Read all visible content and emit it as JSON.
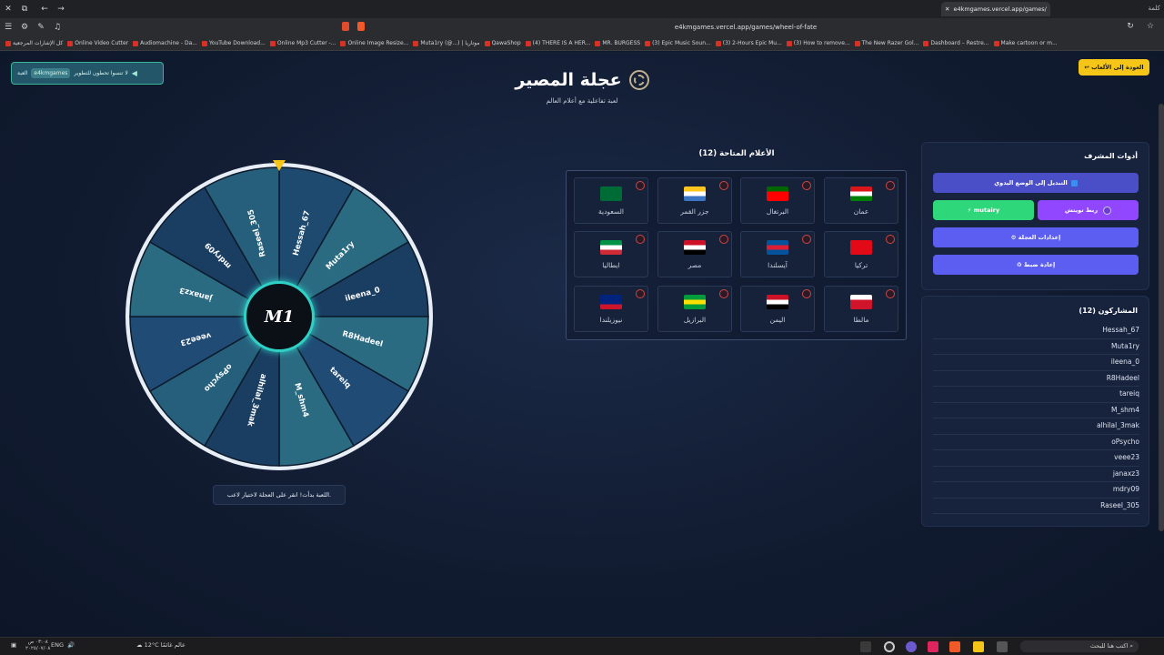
{
  "browser": {
    "tab_title": "e4kmgames.vercel.app/games/",
    "window_title": "كلمة",
    "url": "e4kmgames.vercel.app/games/wheel-of-fate",
    "bookmarks": [
      "كل الإشارات المرجعية",
      "Online Video Cutter",
      "Audiomachine - Da...",
      "YouTube Download...",
      "Online Mp3 Cutter -...",
      "Online Image Resize...",
      "Muta1ry (@...) | موتاريا",
      "QawaShop",
      "(4) THERE IS A HER...",
      "MR. BURGESS",
      "(3) Epic Music Soun...",
      "(3) 2-Hours Epic Mu...",
      "(3) How to remove...",
      "The New Razer Gol...",
      "Dashboard – Restre...",
      "Make cartoon or m..."
    ]
  },
  "page": {
    "notice_text": "لا تنسوا تحطون للتطوير",
    "notice_chip": "e4kmgames",
    "notice_chip_end": "العبة",
    "back_button": "↩ العودة إلى الألعاب",
    "title": "عجلة المصير",
    "subtitle": "لعبة تفاعلية مع أعلام العالم",
    "status_text": "اللعبة بدأت! انقر على العجلة لاختيار لاعب."
  },
  "wheel": {
    "hub_logo": "M1",
    "segments": [
      "Hessah_67",
      "Muta1ry",
      "ileena_0",
      "R8Hadeel",
      "tareiq",
      "M_shm4",
      "alhilal_3mak",
      "oPsycho",
      "veee23",
      "janaxz3",
      "mdry09",
      "Raseel_305"
    ],
    "colors": [
      "#1d4a6e",
      "#2a6b82",
      "#1a3d62",
      "#2a6b82",
      "#1f4b74",
      "#2a6b82",
      "#1a3d62",
      "#265f7c",
      "#1f4b74",
      "#2a6b82",
      "#1a3d62",
      "#265f7c"
    ]
  },
  "flags": {
    "title": "الأعلام المتاحة (12)",
    "items": [
      {
        "name": "عمان",
        "colors": [
          "#db161b",
          "#ffffff",
          "#008000"
        ]
      },
      {
        "name": "البرتغال",
        "colors": [
          "#006600",
          "#ff0000",
          "#ff0000"
        ]
      },
      {
        "name": "جزر القمر",
        "colors": [
          "#ffc61e",
          "#ffffff",
          "#3a75c4"
        ]
      },
      {
        "name": "السعودية",
        "colors": [
          "#006c35",
          "#006c35",
          "#006c35"
        ]
      },
      {
        "name": "تركيا",
        "colors": [
          "#e30a17",
          "#e30a17",
          "#e30a17"
        ]
      },
      {
        "name": "آيسلندا",
        "colors": [
          "#02529c",
          "#dc1e35",
          "#02529c"
        ]
      },
      {
        "name": "مصر",
        "colors": [
          "#ce1126",
          "#ffffff",
          "#000000"
        ]
      },
      {
        "name": "ايطاليا",
        "colors": [
          "#009246",
          "#ffffff",
          "#ce2b37"
        ]
      },
      {
        "name": "مالطا",
        "colors": [
          "#ffffff",
          "#cf142b",
          "#cf142b"
        ]
      },
      {
        "name": "اليمن",
        "colors": [
          "#ce1126",
          "#ffffff",
          "#000000"
        ]
      },
      {
        "name": "البرازيل",
        "colors": [
          "#009c3b",
          "#ffdf00",
          "#009c3b"
        ]
      },
      {
        "name": "نيوزيلندا",
        "colors": [
          "#00247d",
          "#00247d",
          "#cc142b"
        ]
      }
    ]
  },
  "admin": {
    "title": "أدوات المشرف",
    "manual_mode": "التبديل إلى الوضع اليدوي",
    "twitch_link": "ربط تويتش",
    "streamer_button": "⚡ mutairy",
    "wheel_settings": "⚙ إعدادات العجلة",
    "reset": "♻ إعادة ضبط",
    "colors": {
      "manual": "#4a4fc8",
      "twitch": "#9147ff",
      "streamer": "#2ed87a",
      "settings": "#5b5ef0",
      "reset": "#5b5ef0"
    }
  },
  "participants": {
    "title": "المشاركون (12)",
    "names": [
      "Hessah_67",
      "Muta1ry",
      "ileena_0",
      "R8Hadeel",
      "tareiq",
      "M_shm4",
      "alhilal_3mak",
      "oPsycho",
      "veee23",
      "janaxz3",
      "mdry09",
      "Raseel_305"
    ]
  },
  "taskbar": {
    "weather": "12°C عالم غائمًا",
    "lang": "ENG",
    "time": "٠٣:٠٨ ص",
    "date": "٢٠٢٥/٠٧/٠٨",
    "search": "اكتب هنا للبحث"
  }
}
